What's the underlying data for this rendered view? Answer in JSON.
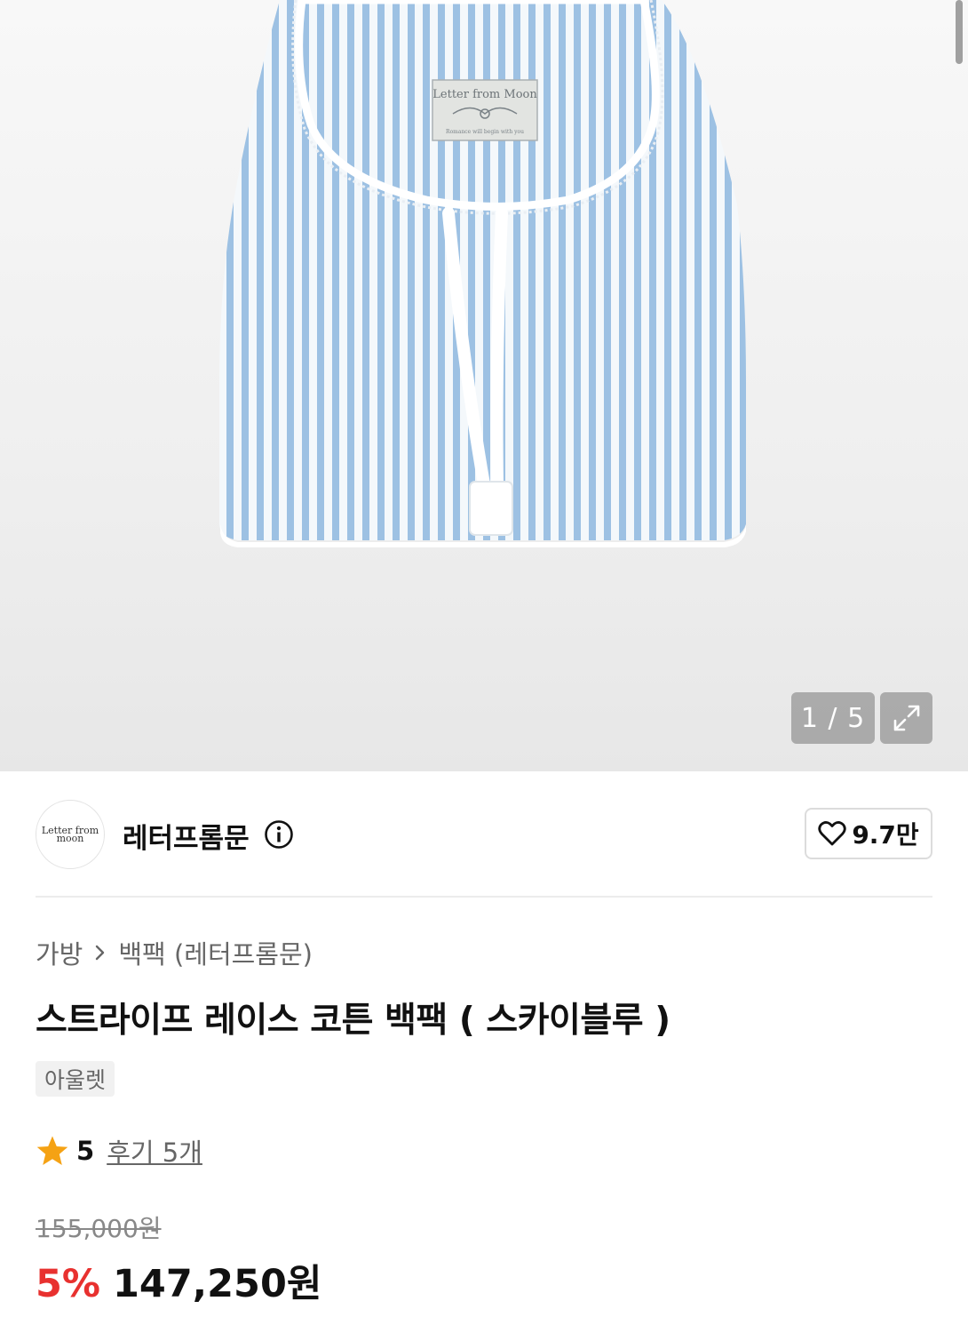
{
  "gallery": {
    "image_alt": "Letter from Moon",
    "label_text": "Letter from Moon",
    "label_subtext": "Romance will begin with you",
    "counter": "1 / 5"
  },
  "seller": {
    "logo_text": "Letter from moon",
    "name": "레터프롬문",
    "likes": "9.7만"
  },
  "breadcrumb": {
    "category": "가방",
    "subcategory": "백팩 (레터프롬문)"
  },
  "product": {
    "title": "스트라이프 레이스 코튼 백팩 ( 스카이블루 )",
    "tag": "아울렛",
    "rating": "5",
    "reviews": "후기 5개",
    "original_price": "155,000원",
    "discount": "5%",
    "price": "147,250원"
  },
  "colors": {
    "accent_red": "#e8312f",
    "star": "#f5a214",
    "stripe_blue": "#9dc1e3"
  }
}
